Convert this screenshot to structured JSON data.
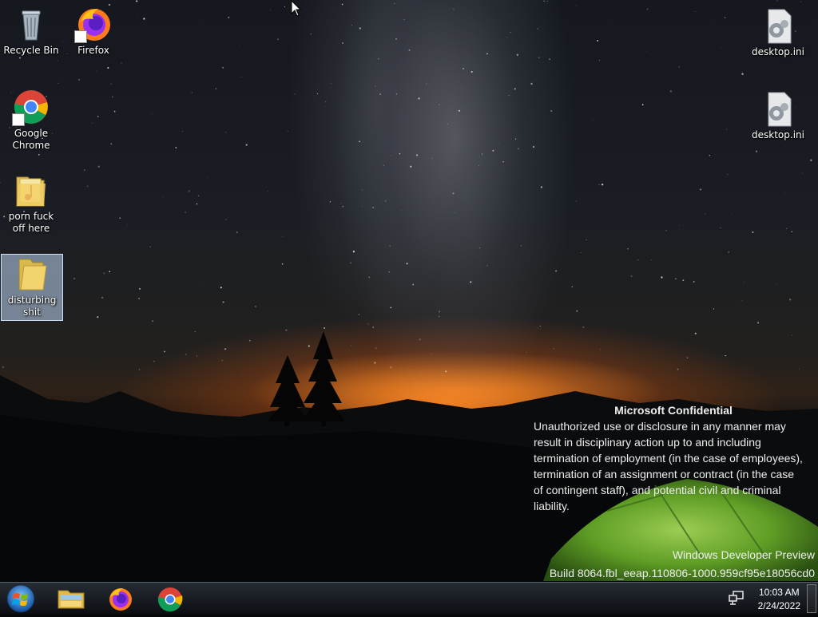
{
  "desktop": {
    "icons": [
      {
        "label": "Recycle Bin",
        "icon": "recycle-bin-icon"
      },
      {
        "label": "Firefox",
        "icon": "firefox-icon"
      },
      {
        "label": "Google Chrome",
        "icon": "chrome-icon"
      },
      {
        "label": "porn fuck off here",
        "icon": "music-folder-icon"
      },
      {
        "label": "disturbing shit",
        "icon": "folder-icon"
      },
      {
        "label": "desktop.ini",
        "icon": "settings-file-icon"
      },
      {
        "label": "desktop.ini",
        "icon": "settings-file-icon"
      }
    ],
    "selected_icon": "disturbing shit"
  },
  "watermark": {
    "title": "Microsoft Confidential",
    "body": "Unauthorized use or disclosure in any manner may result in disciplinary action up to and including termination of employment (in the case of employees), termination of an assignment or contract (in the case of contingent staff), and potential civil and criminal liability.",
    "edition": "Windows Developer Preview",
    "build": "Build 8064.fbl_eeap.110806-1000.959cf95e18056cd0"
  },
  "taskbar": {
    "start": "windows-start-orb-icon",
    "pinned": [
      {
        "name": "file-explorer",
        "icon": "file-explorer-icon"
      },
      {
        "name": "firefox",
        "icon": "firefox-icon"
      },
      {
        "name": "chrome",
        "icon": "chrome-icon"
      }
    ],
    "tray_icon": "network-icon",
    "time": "10:03 AM",
    "date": "2/24/2022"
  },
  "colors": {
    "taskbar": "#14171c",
    "selection": "#bed7f5",
    "sunset": "#ff8c28",
    "tent": "#8fd63a"
  }
}
